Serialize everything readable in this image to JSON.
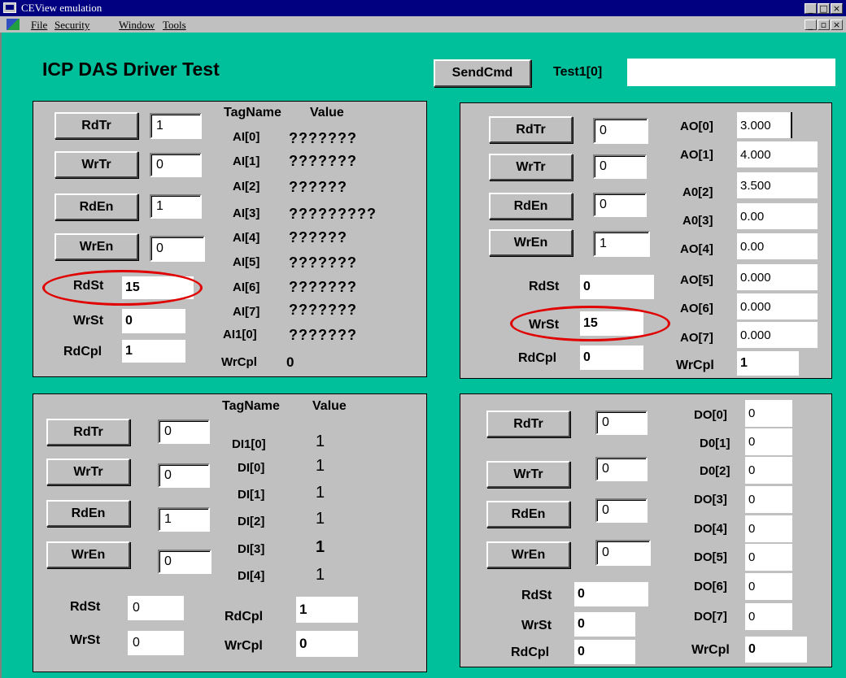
{
  "window": {
    "title": "CEView emulation",
    "controls": [
      "_",
      "□",
      "×"
    ]
  },
  "menu": {
    "items": [
      "File",
      "Security",
      "Window",
      "Tools"
    ],
    "mdi_controls": [
      "_",
      "▫",
      "×"
    ]
  },
  "header": {
    "title": "ICP DAS Driver Test",
    "send_button": "SendCmd",
    "test_label": "Test1[0]",
    "test_value": ""
  },
  "ai_panel": {
    "buttons": [
      "RdTr",
      "WrTr",
      "RdEn",
      "WrEn"
    ],
    "button_values": [
      "1",
      "0",
      "1",
      "0"
    ],
    "status": [
      {
        "label": "RdSt",
        "value": "15"
      },
      {
        "label": "WrSt",
        "value": "0"
      },
      {
        "label": "RdCpl",
        "value": "1"
      }
    ],
    "col_tag": "TagName",
    "col_value": "Value",
    "tags": [
      "AI[0]",
      "AI[1]",
      "AI[2]",
      "AI[3]",
      "AI[4]",
      "AI[5]",
      "AI[6]",
      "AI[7]",
      "AI1[0]"
    ],
    "values": [
      "???????",
      "???????",
      "??????",
      "?????????",
      "??????",
      "???????",
      "???????",
      "???????",
      "???????"
    ],
    "wrcpl_label": "WrCpl",
    "wrcpl_value": "0"
  },
  "ao_panel": {
    "buttons": [
      "RdTr",
      "WrTr",
      "RdEn",
      "WrEn"
    ],
    "button_values": [
      "0",
      "0",
      "0",
      "1"
    ],
    "status": [
      {
        "label": "RdSt",
        "value": "0"
      },
      {
        "label": "WrSt",
        "value": "15"
      },
      {
        "label": "RdCpl",
        "value": "0"
      }
    ],
    "tags": [
      "AO[0]",
      "AO[1]",
      "A0[2]",
      "A0[3]",
      "AO[4]",
      "AO[5]",
      "AO[6]",
      "AO[7]"
    ],
    "values": [
      "3.000",
      "4.000",
      "3.500",
      "0.00",
      "0.00",
      "0.000",
      "0.000",
      "0.000"
    ],
    "wrcpl_label": "WrCpl",
    "wrcpl_value": "1"
  },
  "di_panel": {
    "buttons": [
      "RdTr",
      "WrTr",
      "RdEn",
      "WrEn"
    ],
    "button_values": [
      "0",
      "0",
      "1",
      "0"
    ],
    "col_tag": "TagName",
    "col_value": "Value",
    "tags": [
      "DI1[0]",
      "DI[0]",
      "DI[1]",
      "DI[2]",
      "DI[3]",
      "DI[4]"
    ],
    "values": [
      "1",
      "1",
      "1",
      "1",
      "1",
      "1"
    ],
    "status": [
      {
        "label": "RdSt",
        "value": "0"
      },
      {
        "label": "WrSt",
        "value": "0"
      }
    ],
    "cpl": [
      {
        "label": "RdCpl",
        "value": "1"
      },
      {
        "label": "WrCpl",
        "value": "0"
      }
    ]
  },
  "do_panel": {
    "buttons": [
      "RdTr",
      "WrTr",
      "RdEn",
      "WrEn"
    ],
    "button_values": [
      "0",
      "0",
      "0",
      "0"
    ],
    "tags": [
      "DO[0]",
      "D0[1]",
      "D0[2]",
      "DO[3]",
      "DO[4]",
      "DO[5]",
      "DO[6]",
      "DO[7]"
    ],
    "values": [
      "0",
      "0",
      "0",
      "0",
      "0",
      "0",
      "0",
      "0"
    ],
    "status": [
      {
        "label": "RdSt",
        "value": "0"
      },
      {
        "label": "WrSt",
        "value": "0"
      },
      {
        "label": "RdCpl",
        "value": "0"
      }
    ],
    "wrcpl_label": "WrCpl",
    "wrcpl_value": "0"
  },
  "colors": {
    "background": "#00c09c",
    "panel": "#c0c0c0",
    "highlight_ring": "#e00000",
    "titlebar": "#000080"
  }
}
